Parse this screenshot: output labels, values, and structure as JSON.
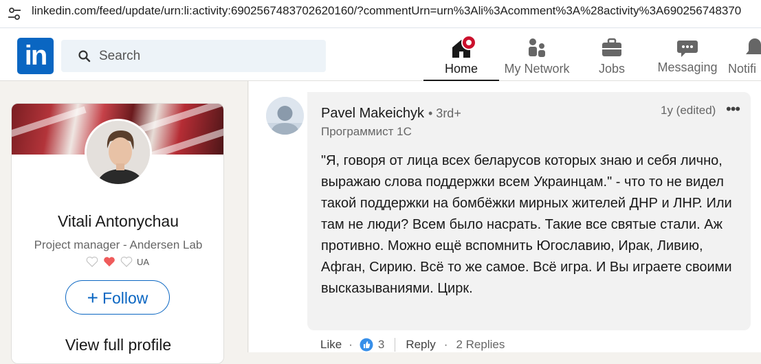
{
  "browser": {
    "url": "linkedin.com/feed/update/urn:li:activity:6902567483702620160/?commentUrn=urn%3Ali%3Acomment%3A%28activity%3A690256748370"
  },
  "nav": {
    "logo": "in",
    "search_placeholder": "Search",
    "items": [
      {
        "label": "Home",
        "icon": "home-icon"
      },
      {
        "label": "My Network",
        "icon": "network-icon"
      },
      {
        "label": "Jobs",
        "icon": "briefcase-icon"
      },
      {
        "label": "Messaging",
        "icon": "messaging-icon"
      },
      {
        "label": "Notifi",
        "icon": "bell-icon"
      }
    ]
  },
  "profile": {
    "name": "Vitali Antonychau",
    "title": "Project manager - Andersen Lab",
    "flag_text": "UA",
    "follow_label": "Follow",
    "view_profile_label": "View full profile"
  },
  "comment": {
    "author": "Pavel Makeichyk",
    "degree": "• 3rd+",
    "headline": "Программист 1С",
    "time": "1y (edited)",
    "more": "•••",
    "text": "\"Я, говоря от лица всех беларусов которых знаю и себя лично, выражаю слова поддержки всем Украинцам.\" - что то не видел такой поддержки на бомбёжки мирных жителей ДНР и ЛНР. Или там не люди? Всем было насрать. Такие все святые стали. Аж противно. Можно ещё вспомнить Югославию, Ирак, Ливию, Афган, Сирию. Всё то же самое. Всё игра. И Вы играете своими высказываниями. Цирк.",
    "like_label": "Like",
    "like_count": "3",
    "reply_label": "Reply",
    "replies_label": "2 Replies"
  },
  "colors": {
    "brand": "#0a66c2",
    "badge": "#cb112d",
    "reaction_like": "#378fe9"
  }
}
